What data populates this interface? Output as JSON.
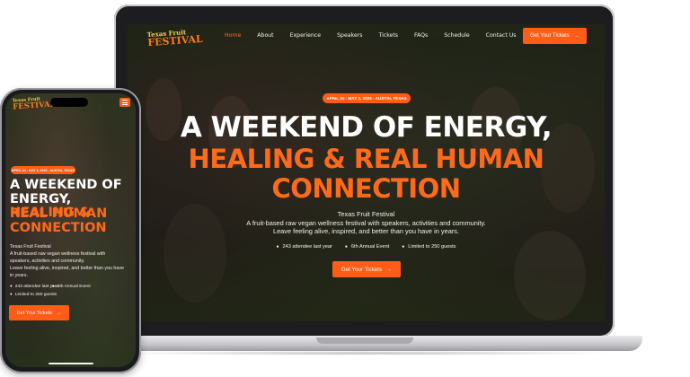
{
  "brand": {
    "logo_line1": "Texas Fruit",
    "logo_line2": "FESTIVAL",
    "accent": "#ff5d16",
    "accent_text": "#ff6a1a"
  },
  "laptop": {
    "nav": {
      "items": [
        "Home",
        "About",
        "Experience",
        "Speakers",
        "Tickets",
        "FAQs",
        "Schedule",
        "Contact Us"
      ],
      "active": "Home",
      "cta_label": "Get Your Tickets",
      "cta_icon": "arrow-right-icon"
    },
    "hero": {
      "badge": "APRIL 30 - MAY 3, 2026 - AUSTIN, TEXAS",
      "title_line1": "A WEEKEND OF ENERGY,",
      "title_line2": "HEALING & REAL HUMAN",
      "title_line3": "CONNECTION",
      "sub_line1": "Texas Fruit Festival",
      "sub_line2": "A fruit-based raw vegan wellness festival with speakers, activities and community.",
      "sub_line3": "Leave feeling alive, inspired, and better than you have in years.",
      "bullets": [
        "243 attendee last year",
        "6th Annual Event",
        "Limited to 250 guests"
      ],
      "cta_label": "Get Your Tickets",
      "cta_icon": "arrow-right-icon"
    }
  },
  "phone": {
    "menu_icon": "hamburger-icon",
    "hero": {
      "badge": "APRIL 30 - MAY 3, 2026 - AUSTIN, TEXAS",
      "title_line1": "A WEEKEND OF",
      "title_line2_white": "ENERGY, ",
      "title_line2_orange": "HEALING &",
      "title_line3": "REAL HUMAN",
      "title_line4": "CONNECTION",
      "sub_line1": "Texas Fruit Festival",
      "sub_line2": "A fruit-based raw vegan wellness festival with",
      "sub_line3": "speakers, activities and community.",
      "sub_line4": "Leave feeling alive, inspired, and better than you have",
      "sub_line5": "in years.",
      "bullets": [
        "243 attendee last year",
        "6th Annual Event",
        "Limited to 250 guests"
      ],
      "cta_label": "Get Your Tickets",
      "cta_icon": "arrow-right-icon"
    }
  }
}
